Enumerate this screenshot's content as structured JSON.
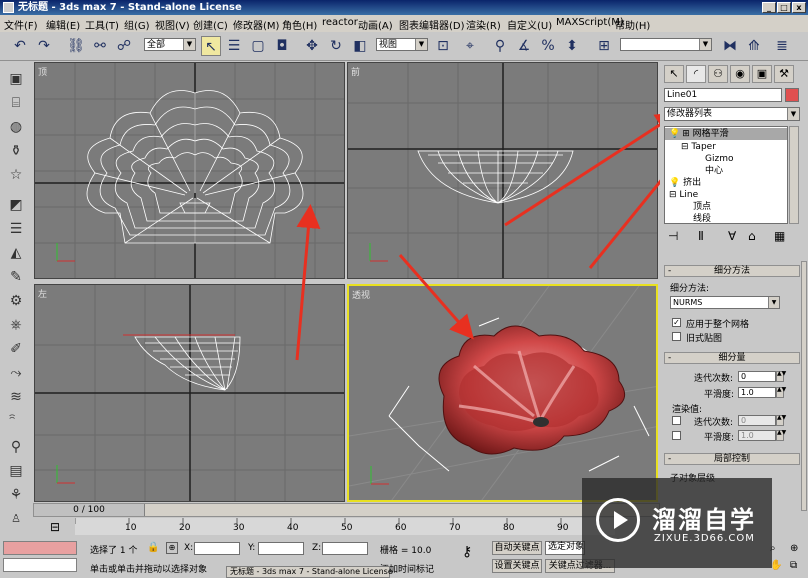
{
  "window": {
    "title": "无标题 - 3ds max 7 - Stand-alone License",
    "btn_min": "_",
    "btn_max": "□",
    "btn_close": "x"
  },
  "menu": [
    "文件(F)",
    "编辑(E)",
    "工具(T)",
    "组(G)",
    "视图(V)",
    "创建(C)",
    "修改器(M)",
    "角色(H)",
    "reactor",
    "动画(A)",
    "图表编辑器(D)",
    "渲染(R)",
    "自定义(U)",
    "MAXScript(M)",
    "帮助(H)"
  ],
  "toolbar": {
    "selection_filter": "全部",
    "ref_coord": "视图",
    "named_set": ""
  },
  "viewports": {
    "top": "顶",
    "front": "前",
    "left": "左",
    "persp": "透视"
  },
  "panel": {
    "object_name": "Line01",
    "modifier_list": "修改器列表",
    "stack": [
      "网格平滑",
      "Taper",
      "Gizmo",
      "中心",
      "挤出",
      "Line",
      "顶点",
      "线段"
    ],
    "subdiv_title": "细分方法",
    "subdiv_label": "细分方法:",
    "subdiv_value": "NURMS",
    "apply_whole": "应用于整个网格",
    "old_map": "旧式贴图",
    "subdiv_amount_title": "细分量",
    "iterations_label": "迭代次数:",
    "iterations_value": "0",
    "smoothness_label": "平滑度:",
    "smoothness_value": "1.0",
    "render_label": "渲染值:",
    "r_iterations_label": "迭代次数:",
    "r_iterations_value": "0",
    "r_smoothness_label": "平滑度:",
    "r_smoothness_value": "1.0",
    "local_control_title": "局部控制",
    "subobj_level": "子对象层级"
  },
  "timeline": {
    "frame_label": "0 / 100",
    "ticks": [
      "10",
      "20",
      "30",
      "40",
      "50",
      "60",
      "70",
      "80",
      "90"
    ]
  },
  "status": {
    "selected": "选择了 1 个",
    "x_label": "X:",
    "y_label": "Y:",
    "z_label": "Z:",
    "grid": "栅格 = 10.0",
    "prompt": "单击或单击并拖动以选择对象",
    "add_time_tag": "添加时间标记",
    "auto_key": "自动关键点",
    "set_key": "设置关键点",
    "selected_obj": "选定对象",
    "key_filters": "关键点过滤器..."
  },
  "taskbar": "无标题 - 3ds max 7 - Stand-alone License",
  "watermark": {
    "name": "溜溜自学",
    "url": "ZIXUE.3D66.COM"
  },
  "colors": {
    "object_color": "#e05050",
    "selected_vp_border": "#e8e020",
    "arrow": "#e83020"
  }
}
